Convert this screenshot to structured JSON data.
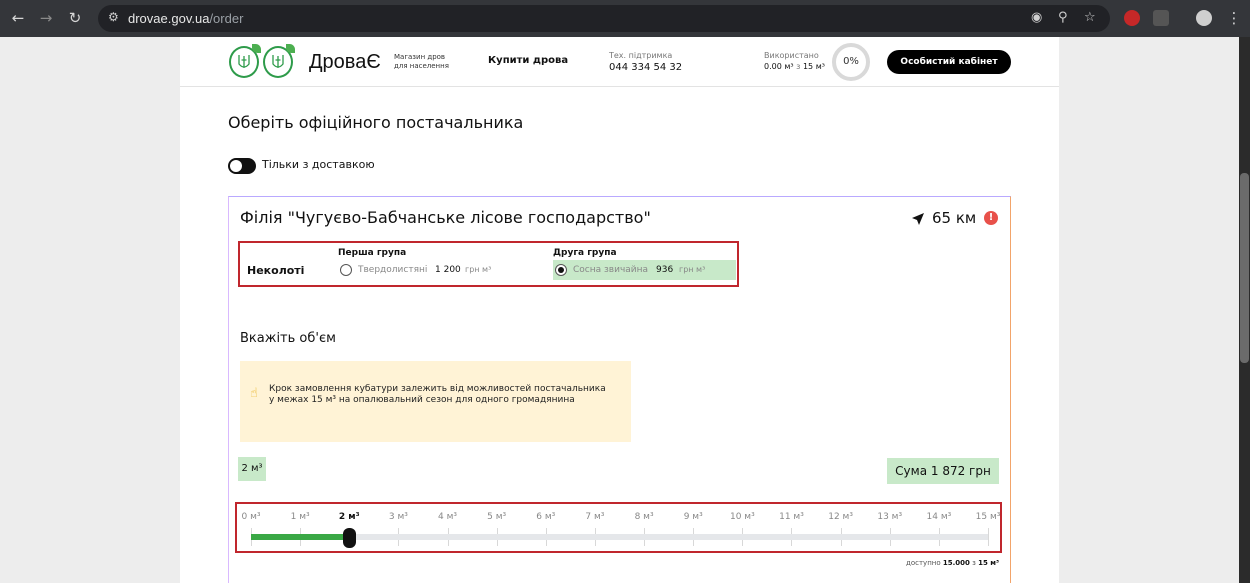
{
  "browser": {
    "url_host": "drovae.gov.ua",
    "url_path": "/order",
    "icons": [
      "back-icon",
      "forward-icon",
      "reload-icon",
      "site-info-icon",
      "tracking-icon",
      "zoom-icon",
      "bookmark-star-icon"
    ]
  },
  "header": {
    "brand": "ДроваЄ",
    "tagline": "Магазин дров для населення",
    "buy_link": "Купити дрова",
    "support_label": "Тех. підтримка",
    "support_phone": "044 334 54 32",
    "used_label": "Використано",
    "used_value": "0.00 м³",
    "used_sep": "з",
    "used_limit": "15 м³",
    "used_percent": "0%",
    "cabinet_button": "Особистий кабінет"
  },
  "main": {
    "title": "Оберіть офіційного постачальника",
    "delivery_toggle_label": "Тільки з доставкою",
    "delivery_toggle_on": false
  },
  "supplier": {
    "branch_name": "Філія \"Чугуєво-Бабчанське лісове господарство\"",
    "distance": "65 км",
    "warning": "!",
    "wood_type": "Неколоті",
    "groups": [
      {
        "label": "Перша група",
        "option": "Твердолистяні",
        "price": "1 200",
        "unit": "грн м³",
        "selected": false
      },
      {
        "label": "Друга група",
        "option": "Сосна звичайна",
        "price": "936",
        "unit": "грн м³",
        "selected": true
      }
    ]
  },
  "volume": {
    "title": "Вкажіть об'єм",
    "note": "Крок замовлення кубатури залежить від можливостей постачальника у межах 15 м³ на опалювальний сезон для одного громадянина",
    "selected_label": "2 м³",
    "sum_label": "Сума 1 872 грн",
    "slider": {
      "min": 0,
      "max": 15,
      "value": 2,
      "ticks": [
        "0 м³",
        "1 м³",
        "2 м³",
        "3 м³",
        "4 м³",
        "5 м³",
        "6 м³",
        "7 м³",
        "8 м³",
        "9 м³",
        "10 м³",
        "11 м³",
        "12 м³",
        "13 м³",
        "14 м³",
        "15 м³"
      ]
    },
    "available_prefix": "доступно",
    "available_value": "15.000",
    "available_sep": "з",
    "available_max": "15 м³"
  }
}
